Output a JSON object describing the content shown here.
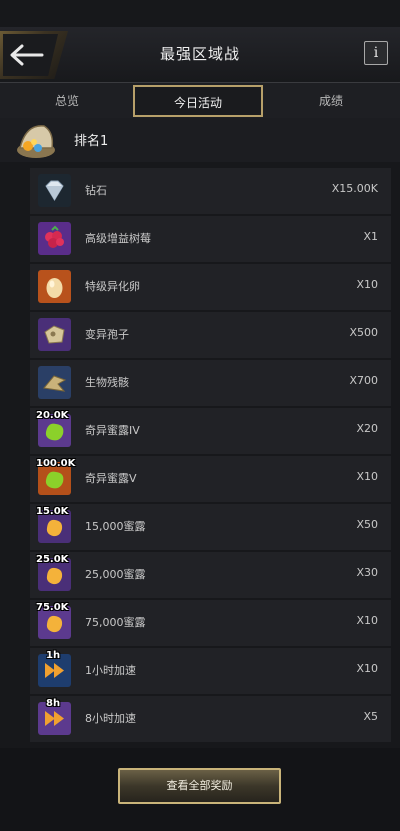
{
  "header": {
    "title": "最强区域战",
    "info_label": "i"
  },
  "tabs": [
    {
      "label": "总览",
      "active": false
    },
    {
      "label": "今日活动",
      "active": true
    },
    {
      "label": "成绩",
      "active": false
    }
  ],
  "rank": {
    "label": "排名1"
  },
  "rewards": [
    {
      "name": "钻石",
      "qty": "X15.00K",
      "icon": "diamond-icon",
      "overlay": ""
    },
    {
      "name": "高级增益树莓",
      "qty": "X1",
      "icon": "raspberry-icon",
      "overlay": ""
    },
    {
      "name": "特级异化卵",
      "qty": "X10",
      "icon": "egg-icon",
      "overlay": ""
    },
    {
      "name": "变异孢子",
      "qty": "X500",
      "icon": "spore-icon",
      "overlay": ""
    },
    {
      "name": "生物残骸",
      "qty": "X700",
      "icon": "remains-icon",
      "overlay": ""
    },
    {
      "name": "奇异蜜露IV",
      "qty": "X20",
      "icon": "honeydew-green-icon",
      "overlay": "20.0K"
    },
    {
      "name": "奇异蜜露V",
      "qty": "X10",
      "icon": "honeydew-green-icon",
      "overlay": "100.0K"
    },
    {
      "name": "15,000蜜露",
      "qty": "X50",
      "icon": "honeydew-gold-icon",
      "overlay": "15.0K"
    },
    {
      "name": "25,000蜜露",
      "qty": "X30",
      "icon": "honeydew-gold-icon",
      "overlay": "25.0K"
    },
    {
      "name": "75,000蜜露",
      "qty": "X10",
      "icon": "honeydew-gold-icon",
      "overlay": "75.0K"
    },
    {
      "name": "1小时加速",
      "qty": "X10",
      "icon": "speedup-icon",
      "overlay": "1h"
    },
    {
      "name": "8小时加速",
      "qty": "X5",
      "icon": "speedup-icon",
      "overlay": "8h"
    }
  ],
  "footer": {
    "button_label": "查看全部奖励"
  }
}
